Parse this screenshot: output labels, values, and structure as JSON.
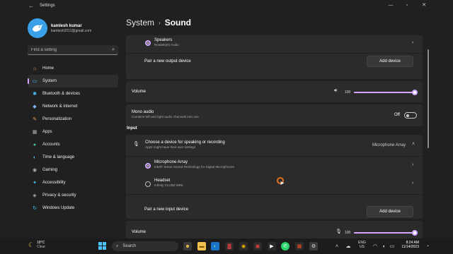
{
  "window": {
    "title": "Settings"
  },
  "profile": {
    "name": "kamlesh kumar",
    "email": "kamlesh2011@gmail.com"
  },
  "search": {
    "placeholder": "Find a setting"
  },
  "nav": [
    {
      "label": "Home",
      "icon": "home-icon",
      "glyph": "⌂",
      "color": "#e6a15c"
    },
    {
      "label": "System",
      "icon": "monitor-icon",
      "glyph": "▭",
      "color": "#4cc2ff",
      "active": true
    },
    {
      "label": "Bluetooth & devices",
      "icon": "bluetooth-icon",
      "glyph": "✱",
      "color": "#4cc2ff"
    },
    {
      "label": "Network & internet",
      "icon": "wifi-icon",
      "glyph": "◆",
      "color": "#8ab4f8"
    },
    {
      "label": "Personalization",
      "icon": "brush-icon",
      "glyph": "✎",
      "color": "#f0a45d"
    },
    {
      "label": "Apps",
      "icon": "apps-icon",
      "glyph": "▦",
      "color": "#b0b0b0"
    },
    {
      "label": "Accounts",
      "icon": "account-icon",
      "glyph": "●",
      "color": "#46c48c"
    },
    {
      "label": "Time & language",
      "icon": "globe-icon",
      "glyph": "◐",
      "color": "#4cc2ff"
    },
    {
      "label": "Gaming",
      "icon": "gamepad-icon",
      "glyph": "◉",
      "color": "#b0b0b0"
    },
    {
      "label": "Accessibility",
      "icon": "accessibility-icon",
      "glyph": "✦",
      "color": "#4cc2ff"
    },
    {
      "label": "Privacy & security",
      "icon": "shield-icon",
      "glyph": "◈",
      "color": "#b0b0b0"
    },
    {
      "label": "Windows Update",
      "icon": "update-icon",
      "glyph": "↻",
      "color": "#4cc2ff"
    }
  ],
  "breadcrumb": {
    "parent": "System",
    "current": "Sound"
  },
  "output": {
    "device_name": "Speakers",
    "device_sub": "Realtek(R) Audio",
    "pair_label": "Pair a new output device",
    "add_label": "Add device",
    "volume_label": "Volume",
    "volume_value": "100",
    "volume_level": 100
  },
  "mono": {
    "title": "Mono audio",
    "sub": "Combine left and right audio channels into one",
    "state": "Off"
  },
  "input": {
    "section": "Input",
    "choose_title": "Choose a device for speaking or recording",
    "choose_sub": "Apps might have their own settings",
    "selected": "Microphone Array",
    "devices": [
      {
        "name": "Microphone Array",
        "sub": "Intel® Smart Sound Technology for Digital Microphones",
        "selected": true
      },
      {
        "name": "Headset",
        "sub": "Infinity CLUBZ MINI",
        "selected": false
      }
    ],
    "pair_label": "Pair a new input device",
    "add_label": "Add device",
    "volume_label": "Volume",
    "volume_value": "100",
    "volume_level": 100
  },
  "taskbar": {
    "temp": "18°C",
    "condition": "Clear",
    "search": "Search",
    "lang": "ENG",
    "region": "US",
    "time": "8:24 AM",
    "date": "11/14/2023"
  },
  "colors": {
    "accent": "#d4a8ff",
    "background": "#202020",
    "card": "#2b2b2b"
  }
}
